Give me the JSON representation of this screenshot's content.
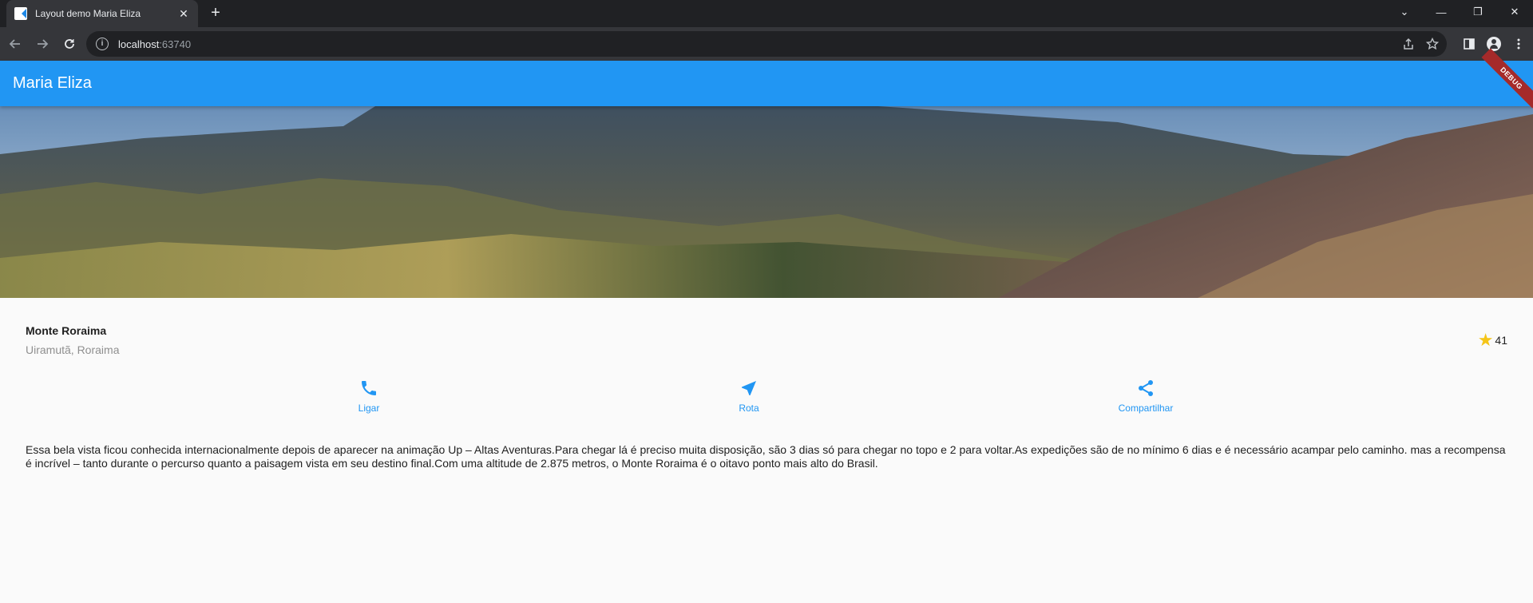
{
  "browser": {
    "tab_title": "Layout demo Maria Eliza",
    "tab_close": "✕",
    "new_tab": "+",
    "url_host": "localhost",
    "url_port": ":63740",
    "win_controls": {
      "tabs_menu": "⌄",
      "minimize": "—",
      "restore": "❐",
      "close": "✕"
    }
  },
  "app": {
    "title": "Maria Eliza",
    "debug_banner": "DEBUG",
    "primary_color": "#2196f3"
  },
  "place": {
    "name": "Monte Roraima",
    "location": "Uiramutã, Roraima",
    "star": "★",
    "rating_count": "41"
  },
  "actions": [
    {
      "label": "Ligar",
      "icon": "phone-icon"
    },
    {
      "label": "Rota",
      "icon": "navigation-icon"
    },
    {
      "label": "Compartilhar",
      "icon": "share-icon"
    }
  ],
  "description": "Essa bela vista ficou conhecida internacionalmente depois de aparecer na animação Up – Altas Aventuras.Para chegar lá é preciso muita disposição, são 3 dias só para chegar no topo e 2 para voltar.As expedições são de no mínimo 6 dias e é necessário acampar pelo caminho.  mas a recompensa é incrível – tanto durante o percurso quanto a paisagem vista em seu destino final.Com uma altitude de 2.875 metros, o Monte Roraima é o oitavo ponto mais alto do Brasil."
}
